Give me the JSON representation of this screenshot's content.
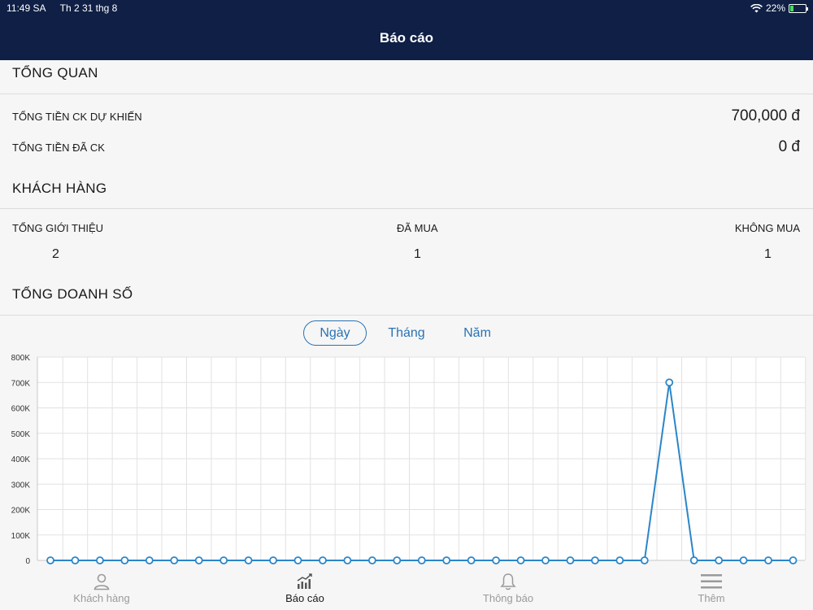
{
  "status_bar": {
    "time": "11:49 SA",
    "date": "Th 2 31 thg 8",
    "battery": "22%",
    "battery_level": 0.22
  },
  "header": {
    "title": "Báo cáo"
  },
  "overview": {
    "title": "TỔNG QUAN",
    "rows": [
      {
        "label": "TỔNG TIỀN CK DỰ KHIẾN",
        "value": "700,000 đ"
      },
      {
        "label": "TỔNG TIỀN ĐÃ CK",
        "value": "0 đ"
      }
    ]
  },
  "customers": {
    "title": "KHÁCH HÀNG",
    "columns": [
      {
        "label": "TỔNG GIỚI THIỆU",
        "value": "2"
      },
      {
        "label": "ĐÃ MUA",
        "value": "1"
      },
      {
        "label": "KHÔNG MUA",
        "value": "1"
      }
    ]
  },
  "sales": {
    "title": "TỔNG DOANH SỐ",
    "tabs": [
      {
        "label": "Ngày",
        "active": true
      },
      {
        "label": "Tháng",
        "active": false
      },
      {
        "label": "Năm",
        "active": false
      }
    ]
  },
  "chart_data": {
    "type": "line",
    "x": [
      1,
      2,
      3,
      4,
      5,
      6,
      7,
      8,
      9,
      10,
      11,
      12,
      13,
      14,
      15,
      16,
      17,
      18,
      19,
      20,
      21,
      22,
      23,
      24,
      25,
      26,
      27,
      28,
      29,
      30,
      31
    ],
    "series": [
      {
        "values": [
          0,
          0,
          0,
          0,
          0,
          0,
          0,
          0,
          0,
          0,
          0,
          0,
          0,
          0,
          0,
          0,
          0,
          0,
          0,
          0,
          0,
          0,
          0,
          0,
          0,
          700000,
          0,
          0,
          0,
          0,
          0
        ]
      }
    ],
    "y_ticks": [
      "0",
      "100K",
      "200K",
      "300K",
      "400K",
      "500K",
      "600K",
      "700K",
      "800K"
    ],
    "ylim": [
      0,
      800000
    ],
    "grid": true,
    "line_color": "#2a86c9"
  },
  "tabbar": {
    "items": [
      {
        "label": "Khách hàng",
        "icon": "person-icon",
        "active": false
      },
      {
        "label": "Báo cáo",
        "icon": "report-chart-icon",
        "active": true
      },
      {
        "label": "Thông báo",
        "icon": "bell-icon",
        "active": false
      },
      {
        "label": "Thêm",
        "icon": "menu-icon",
        "active": false
      }
    ]
  }
}
